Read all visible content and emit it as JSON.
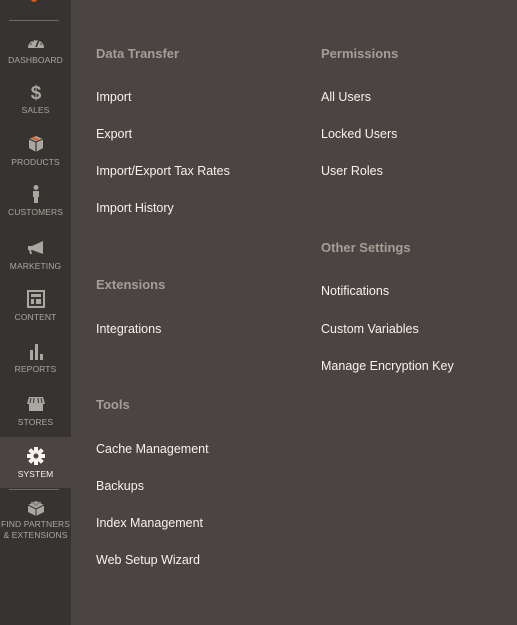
{
  "sidebar": {
    "items": [
      {
        "label": "DASHBOARD",
        "icon": "dashboard-icon"
      },
      {
        "label": "SALES",
        "icon": "dollar-icon"
      },
      {
        "label": "PRODUCTS",
        "icon": "box-icon"
      },
      {
        "label": "CUSTOMERS",
        "icon": "person-icon"
      },
      {
        "label": "MARKETING",
        "icon": "megaphone-icon"
      },
      {
        "label": "CONTENT",
        "icon": "layout-icon"
      },
      {
        "label": "REPORTS",
        "icon": "bar-chart-icon"
      },
      {
        "label": "STORES",
        "icon": "storefront-icon"
      },
      {
        "label": "SYSTEM",
        "icon": "gear-icon",
        "active": true
      },
      {
        "label": "FIND PARTNERS",
        "label2": "& EXTENSIONS",
        "icon": "lego-brick-icon"
      }
    ]
  },
  "menu": {
    "data_transfer": {
      "title": "Data Transfer",
      "links": [
        "Import",
        "Export",
        "Import/Export Tax Rates",
        "Import History"
      ]
    },
    "extensions": {
      "title": "Extensions",
      "links": [
        "Integrations"
      ]
    },
    "tools": {
      "title": "Tools",
      "links": [
        "Cache Management",
        "Backups",
        "Index Management",
        "Web Setup Wizard"
      ]
    },
    "permissions": {
      "title": "Permissions",
      "links": [
        "All Users",
        "Locked Users",
        "User Roles"
      ]
    },
    "other_settings": {
      "title": "Other Settings",
      "links": [
        "Notifications",
        "Custom Variables",
        "Manage Encryption Key"
      ]
    }
  },
  "colors": {
    "accent": "#eb5202",
    "sidebar_bg": "#373330",
    "panel_bg": "#4a4542"
  }
}
